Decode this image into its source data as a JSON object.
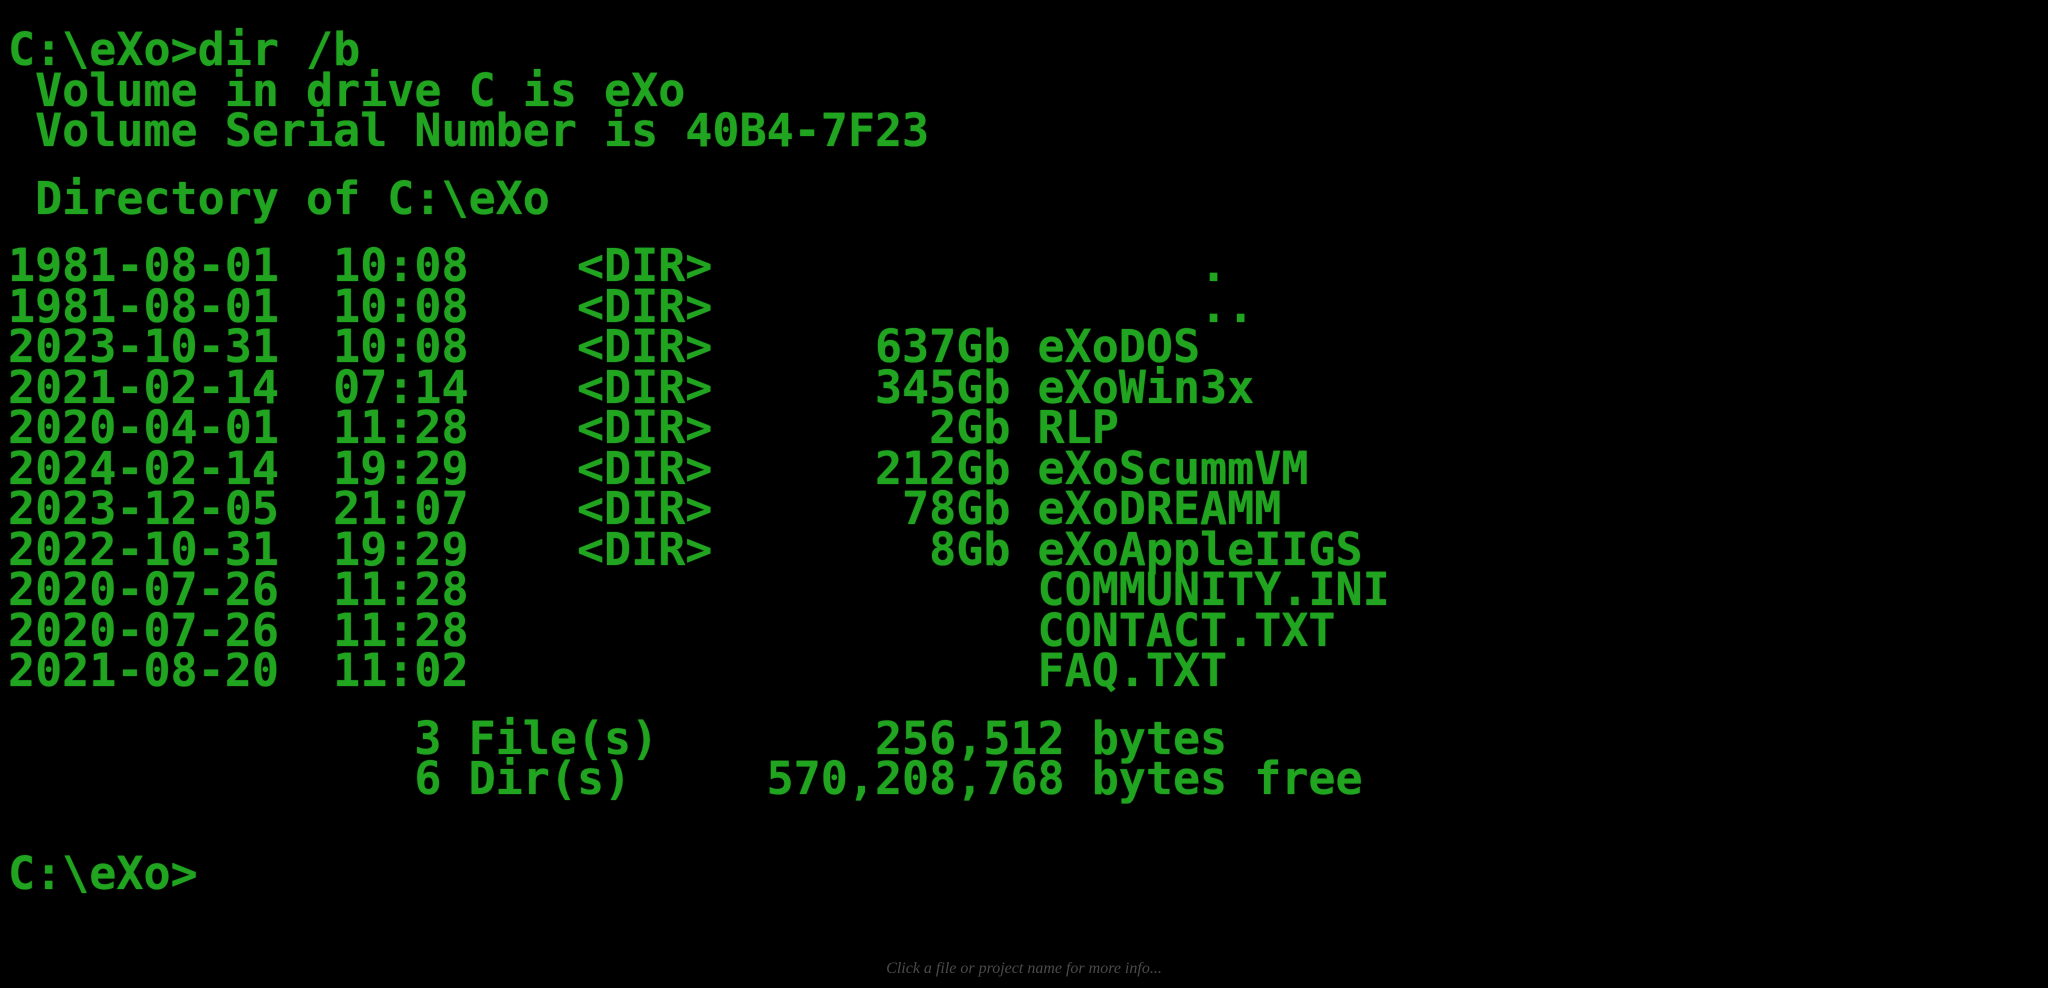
{
  "terminal": {
    "prompt_line": "C:\\eXo>dir /b",
    "volume_line": " Volume in drive C is eXo",
    "serial_line": " Volume Serial Number is 40B4-7F23",
    "directory_of_line": " Directory of C:\\eXo",
    "entries": [
      {
        "date": "1981-08-01",
        "time": "10:08",
        "kind": "<DIR>",
        "size": "",
        "name": "."
      },
      {
        "date": "1981-08-01",
        "time": "10:08",
        "kind": "<DIR>",
        "size": "",
        "name": ".."
      },
      {
        "date": "2023-10-31",
        "time": "10:08",
        "kind": "<DIR>",
        "size": "637Gb",
        "name": "eXoDOS"
      },
      {
        "date": "2021-02-14",
        "time": "07:14",
        "kind": "<DIR>",
        "size": "345Gb",
        "name": "eXoWin3x"
      },
      {
        "date": "2020-04-01",
        "time": "11:28",
        "kind": "<DIR>",
        "size": "2Gb",
        "name": "RLP"
      },
      {
        "date": "2024-02-14",
        "time": "19:29",
        "kind": "<DIR>",
        "size": "212Gb",
        "name": "eXoScummVM"
      },
      {
        "date": "2023-12-05",
        "time": "21:07",
        "kind": "<DIR>",
        "size": "78Gb",
        "name": "eXoDREAMM"
      },
      {
        "date": "2022-10-31",
        "time": "19:29",
        "kind": "<DIR>",
        "size": "8Gb",
        "name": "eXoAppleIIGS"
      },
      {
        "date": "2020-07-26",
        "time": "11:28",
        "kind": "",
        "size": "",
        "name": "COMMUNITY.INI"
      },
      {
        "date": "2020-07-26",
        "time": "11:28",
        "kind": "",
        "size": "",
        "name": "CONTACT.TXT"
      },
      {
        "date": "2021-08-20",
        "time": "11:02",
        "kind": "",
        "size": "",
        "name": "FAQ.TXT"
      }
    ],
    "entry_lines": [
      "1981-08-01  10:08    <DIR>                  .",
      "1981-08-01  10:08    <DIR>                  ..",
      "2023-10-31  10:08    <DIR>      637Gb eXoDOS",
      "2021-02-14  07:14    <DIR>      345Gb eXoWin3x",
      "2020-04-01  11:28    <DIR>        2Gb RLP",
      "2024-02-14  19:29    <DIR>      212Gb eXoScummVM",
      "2023-12-05  21:07    <DIR>       78Gb eXoDREAMM",
      "2022-10-31  19:29    <DIR>        8Gb eXoAppleIIGS",
      "2020-07-26  11:28                     COMMUNITY.INI",
      "2020-07-26  11:28                     CONTACT.TXT",
      "2021-08-20  11:02                     FAQ.TXT"
    ],
    "file_count_line": "               3 File(s)        256,512 bytes",
    "dir_count_line": "               6 Dir(s)     570,208,768 bytes free",
    "file_count": "3",
    "file_count_label": "File(s)",
    "total_bytes": "256,512",
    "bytes_label": "bytes",
    "dir_count": "6",
    "dir_count_label": "Dir(s)",
    "free_bytes": "570,208,768",
    "free_bytes_label": "bytes free",
    "final_prompt": "C:\\eXo>"
  },
  "footer": {
    "hint": "Click a file or project name for more info..."
  },
  "colors": {
    "background": "#000000",
    "text_green": "#21a521",
    "footer_gray": "#4b4b4b"
  }
}
